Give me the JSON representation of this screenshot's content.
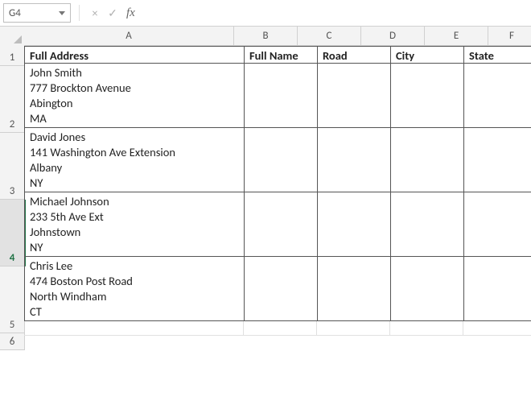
{
  "formula_bar": {
    "name_box": "G4",
    "cancel": "×",
    "confirm": "✓",
    "fx": "fx",
    "formula_value": ""
  },
  "columns": [
    "A",
    "B",
    "C",
    "D",
    "E",
    "F"
  ],
  "row_numbers": [
    "1",
    "2",
    "3",
    "4",
    "5",
    "6"
  ],
  "active_row_index": 3,
  "headers": {
    "A": "Full Address",
    "B": "Full Name",
    "C": "Road",
    "D": "City",
    "E": "State"
  },
  "data_rows": [
    {
      "A": "John Smith\n777 Brockton Avenue\nAbington\nMA",
      "B": "",
      "C": "",
      "D": "",
      "E": ""
    },
    {
      "A": "David Jones\n141 Washington Ave Extension\nAlbany\nNY",
      "B": "",
      "C": "",
      "D": "",
      "E": ""
    },
    {
      "A": "Michael Johnson\n233 5th Ave Ext\nJohnstown\nNY",
      "B": "",
      "C": "",
      "D": "",
      "E": ""
    },
    {
      "A": "Chris Lee\n474 Boston Post Road\nNorth Windham\nCT",
      "B": "",
      "C": "",
      "D": "",
      "E": ""
    }
  ],
  "chart_data": {
    "type": "table",
    "title": "",
    "columns": [
      "Full Address",
      "Full Name",
      "Road",
      "City",
      "State"
    ],
    "rows": [
      [
        "John Smith\n777 Brockton Avenue\nAbington\nMA",
        "",
        "",
        "",
        ""
      ],
      [
        "David Jones\n141 Washington Ave Extension\nAlbany\nNY",
        "",
        "",
        "",
        ""
      ],
      [
        "Michael Johnson\n233 5th Ave Ext\nJohnstown\nNY",
        "",
        "",
        "",
        ""
      ],
      [
        "Chris Lee\n474 Boston Post Road\nNorth Windham\nCT",
        "",
        "",
        "",
        ""
      ]
    ]
  }
}
